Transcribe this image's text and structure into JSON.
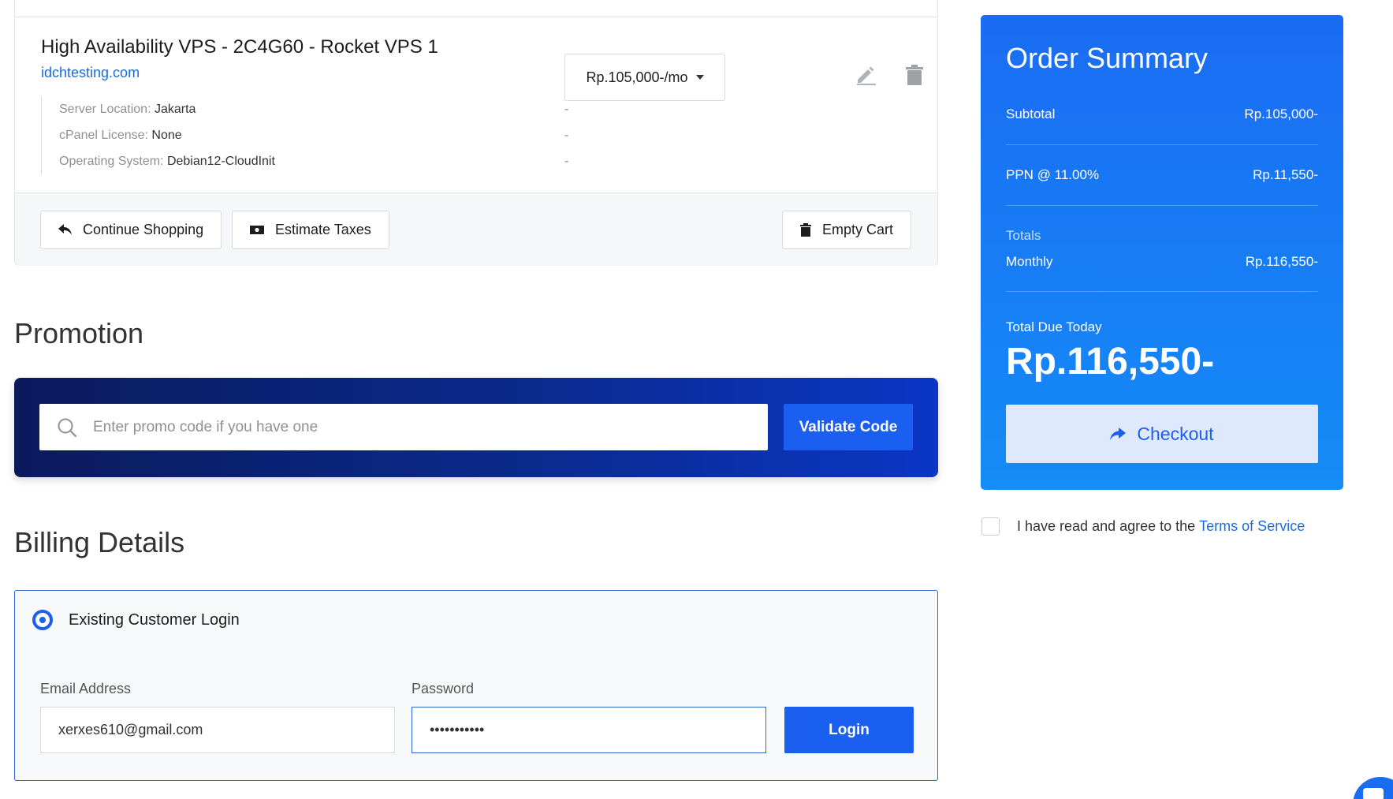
{
  "cart_item": {
    "title": "High Availability VPS - 2C4G60 - Rocket VPS 1",
    "domain": "idchtesting.com",
    "billing_cycle": "Rp.105,000-/mo",
    "config": [
      {
        "label": "Server Location:",
        "value": "Jakarta",
        "price": "-"
      },
      {
        "label": "cPanel License:",
        "value": "None",
        "price": "-"
      },
      {
        "label": "Operating System:",
        "value": "Debian12-CloudInit",
        "price": "-"
      }
    ]
  },
  "cart_actions": {
    "continue_shopping": "Continue Shopping",
    "estimate_taxes": "Estimate Taxes",
    "empty_cart": "Empty Cart"
  },
  "promotion": {
    "heading": "Promotion",
    "placeholder": "Enter promo code if you have one",
    "validate_label": "Validate Code"
  },
  "billing": {
    "heading": "Billing Details",
    "option_label": "Existing Customer Login",
    "email_label": "Email Address",
    "email_value": "xerxes610@gmail.com",
    "password_label": "Password",
    "password_value": "•••••••••••",
    "login_label": "Login"
  },
  "summary": {
    "title": "Order Summary",
    "subtotal_label": "Subtotal",
    "subtotal_value": "Rp.105,000-",
    "tax_label": "PPN @ 11.00%",
    "tax_value": "Rp.11,550-",
    "totals_label": "Totals",
    "monthly_label": "Monthly",
    "monthly_value": "Rp.116,550-",
    "due_label": "Total Due Today",
    "due_value": "Rp.116,550-",
    "checkout_label": "Checkout"
  },
  "tos": {
    "text": "I have read and agree to the",
    "link": "Terms of Service"
  },
  "colors": {
    "primary": "#1a5ff0",
    "link": "#1a6adf",
    "promo_dark": "#0b1a5c"
  }
}
